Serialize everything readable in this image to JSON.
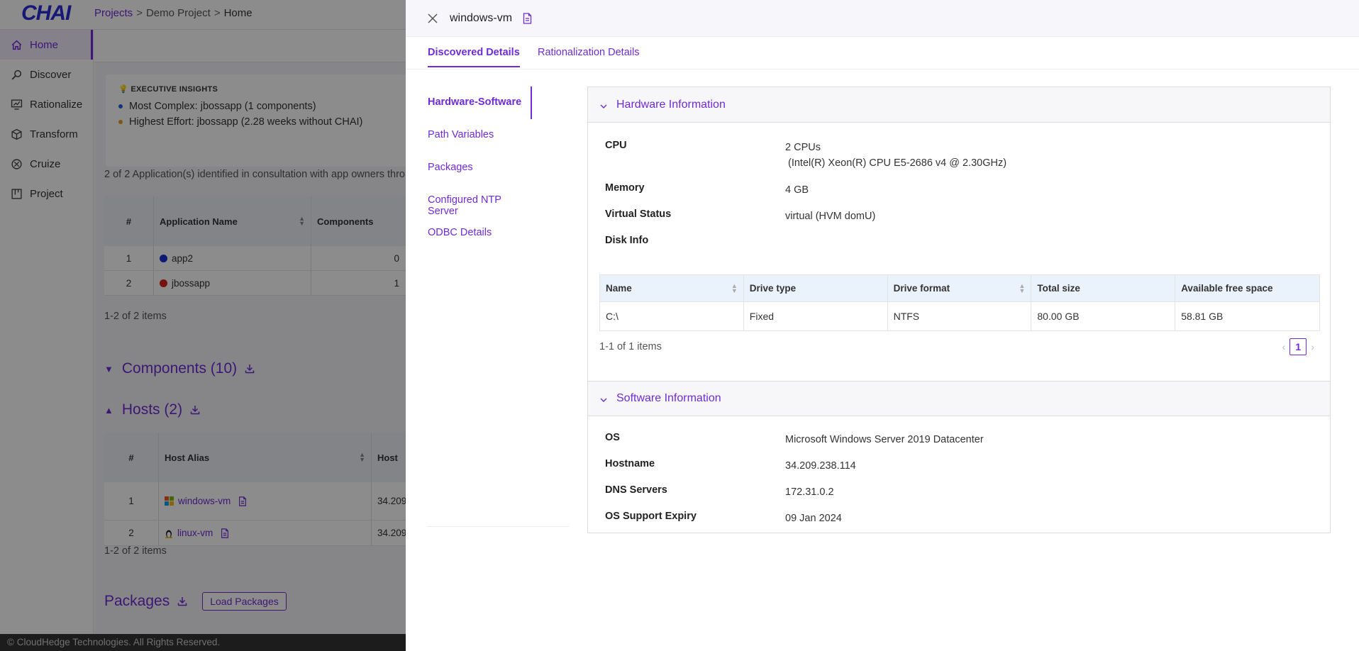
{
  "app": {
    "logo": "CHAI",
    "breadcrumb": {
      "projects": "Projects",
      "sep1": ">",
      "project": "Demo Project",
      "sep2": ">",
      "current": "Home"
    },
    "sidebar": [
      {
        "label": "Home",
        "icon": "home-icon"
      },
      {
        "label": "Discover",
        "icon": "discover-icon"
      },
      {
        "label": "Rationalize",
        "icon": "rationalize-icon"
      },
      {
        "label": "Transform",
        "icon": "transform-icon"
      },
      {
        "label": "Cruize",
        "icon": "cruize-icon"
      },
      {
        "label": "Project",
        "icon": "project-icon"
      }
    ],
    "insights": {
      "title": "💡 EXECUTIVE INSIGHTS",
      "items": [
        {
          "text": "Most Complex: jbossapp (1 components)",
          "color": "#2b5cd6"
        },
        {
          "text": "Highest Effort: jbossapp (2.28 weeks without CHAI)",
          "color": "#e0a020"
        }
      ]
    },
    "apps_description": "2 of 2 Application(s) identified in consultation with app owners thro",
    "apps_table": {
      "headers": [
        "#",
        "Application Name",
        "Components"
      ],
      "rows": [
        {
          "num": "1",
          "name": "app2",
          "dot": "#1a2fd6",
          "components": "0"
        },
        {
          "num": "2",
          "name": "jbossapp",
          "dot": "#d62020",
          "components": "1"
        }
      ],
      "count": "1-2 of 2 items"
    },
    "components_section": {
      "label": "Components",
      "count": "(10)"
    },
    "hosts_section": {
      "label": "Hosts",
      "count": "(2)"
    },
    "hosts_table": {
      "headers": [
        "#",
        "Host Alias",
        "Host"
      ],
      "rows": [
        {
          "num": "1",
          "alias": "windows-vm",
          "os": "windows-icon",
          "host": "34.209"
        },
        {
          "num": "2",
          "alias": "linux-vm",
          "os": "linux-icon",
          "host": "34.209"
        }
      ],
      "count": "1-2 of 2 items"
    },
    "packages_section": {
      "label": "Packages",
      "button": "Load Packages"
    },
    "footer": "© CloudHedge Technologies. All Rights Reserved."
  },
  "drawer": {
    "title": "windows-vm",
    "tabs": [
      "Discovered Details",
      "Rationalization Details"
    ],
    "nav": [
      "Hardware-Software",
      "Path Variables",
      "Packages",
      "Configured NTP Server",
      "ODBC Details"
    ],
    "hardware": {
      "title": "Hardware Information",
      "cpu_label": "CPU",
      "cpu_value_line1": "2 CPUs",
      "cpu_value_line2": "(Intel(R) Xeon(R) CPU E5-2686 v4 @ 2.30GHz)",
      "memory_label": "Memory",
      "memory_value": "4 GB",
      "virtual_label": "Virtual Status",
      "virtual_value": "virtual (HVM domU)",
      "disk_label": "Disk Info",
      "disk_table": {
        "headers": [
          "Name",
          "Drive type",
          "Drive format",
          "Total size",
          "Available free space"
        ],
        "rows": [
          [
            "C:\\",
            "Fixed",
            "NTFS",
            "80.00 GB",
            "58.81 GB"
          ]
        ],
        "count": "1-1 of 1 items",
        "page": "1"
      }
    },
    "software": {
      "title": "Software Information",
      "items": [
        {
          "label": "OS",
          "value": "Microsoft Windows Server 2019 Datacenter"
        },
        {
          "label": "Hostname",
          "value": "34.209.238.114"
        },
        {
          "label": "DNS Servers",
          "value": "172.31.0.2"
        },
        {
          "label": "OS Support Expiry",
          "value": "09 Jan 2024"
        }
      ]
    }
  }
}
